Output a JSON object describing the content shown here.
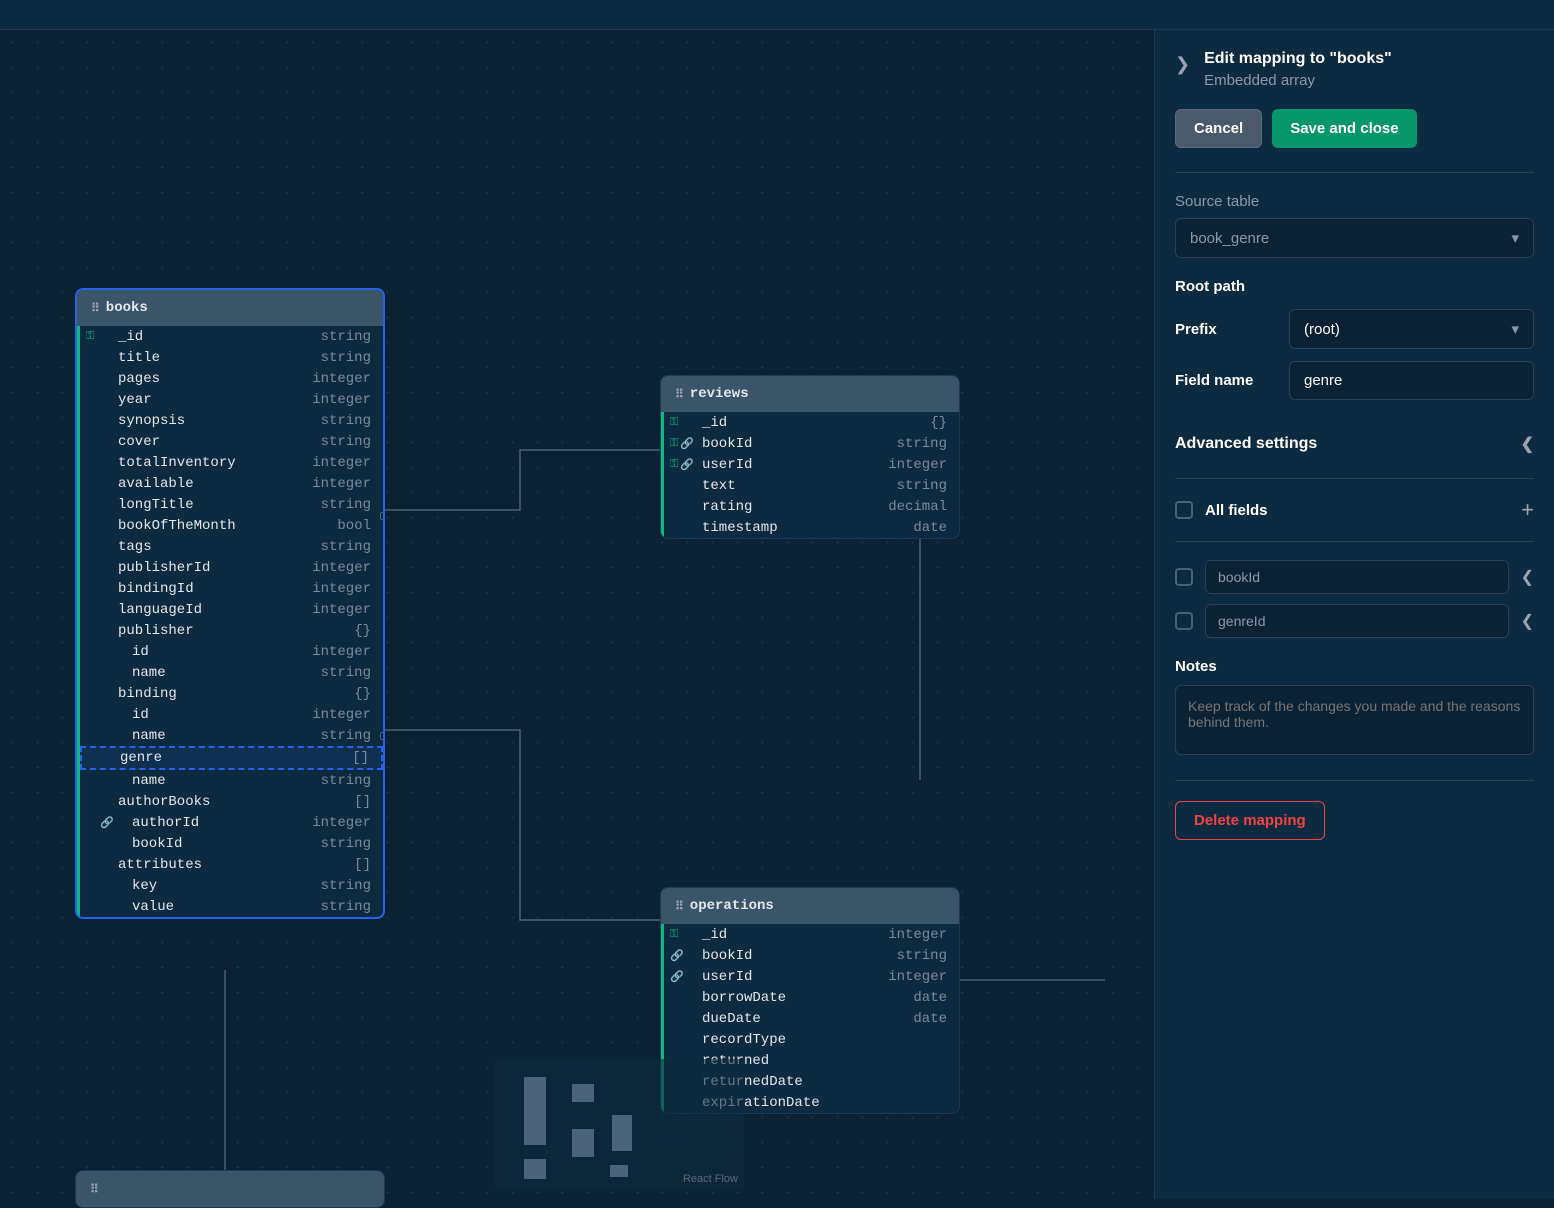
{
  "panel": {
    "title": "Edit mapping to \"books\"",
    "subtitle": "Embedded array",
    "cancel_label": "Cancel",
    "save_label": "Save and close",
    "source_table_label": "Source table",
    "source_table_value": "book_genre",
    "root_path_label": "Root path",
    "prefix_label": "Prefix",
    "prefix_value": "(root)",
    "field_name_label": "Field name",
    "field_name_value": "genre",
    "advanced_label": "Advanced settings",
    "all_fields_label": "All fields",
    "field_checks": [
      "bookId",
      "genreId"
    ],
    "notes_label": "Notes",
    "notes_placeholder": "Keep track of the changes you made and the reasons behind them.",
    "delete_label": "Delete mapping"
  },
  "minimap_attr": "React Flow",
  "entities": {
    "books": {
      "title": "books",
      "fields": [
        {
          "icons": [
            "key"
          ],
          "name": "_id",
          "type": "string"
        },
        {
          "icons": [],
          "name": "title",
          "type": "string"
        },
        {
          "icons": [],
          "name": "pages",
          "type": "integer"
        },
        {
          "icons": [],
          "name": "year",
          "type": "integer"
        },
        {
          "icons": [],
          "name": "synopsis",
          "type": "string"
        },
        {
          "icons": [],
          "name": "cover",
          "type": "string"
        },
        {
          "icons": [],
          "name": "totalInventory",
          "type": "integer"
        },
        {
          "icons": [],
          "name": "available",
          "type": "integer"
        },
        {
          "icons": [],
          "name": "longTitle",
          "type": "string"
        },
        {
          "icons": [],
          "name": "bookOfTheMonth",
          "type": "bool"
        },
        {
          "icons": [],
          "name": "tags",
          "type": "string"
        },
        {
          "icons": [],
          "name": "publisherId",
          "type": "integer"
        },
        {
          "icons": [],
          "name": "bindingId",
          "type": "integer"
        },
        {
          "icons": [],
          "name": "languageId",
          "type": "integer"
        },
        {
          "icons": [],
          "name": "publisher",
          "type": "{}"
        },
        {
          "icons": [],
          "name": "id",
          "type": "integer",
          "indent": true
        },
        {
          "icons": [],
          "name": "name",
          "type": "string",
          "indent": true
        },
        {
          "icons": [],
          "name": "binding",
          "type": "{}"
        },
        {
          "icons": [],
          "name": "id",
          "type": "integer",
          "indent": true
        },
        {
          "icons": [],
          "name": "name",
          "type": "string",
          "indent": true
        },
        {
          "icons": [],
          "name": "genre",
          "type": "[]",
          "highlighted": true
        },
        {
          "icons": [],
          "name": "name",
          "type": "string",
          "indent": true
        },
        {
          "icons": [],
          "name": "authorBooks",
          "type": "[]"
        },
        {
          "icons": [
            "link"
          ],
          "name": "authorId",
          "type": "integer",
          "indent": true
        },
        {
          "icons": [],
          "name": "bookId",
          "type": "string",
          "indent": true
        },
        {
          "icons": [],
          "name": "attributes",
          "type": "[]"
        },
        {
          "icons": [],
          "name": "key",
          "type": "string",
          "indent": true
        },
        {
          "icons": [],
          "name": "value",
          "type": "string",
          "indent": true
        }
      ]
    },
    "reviews": {
      "title": "reviews",
      "fields": [
        {
          "icons": [
            "key"
          ],
          "name": "_id",
          "type": "{}"
        },
        {
          "icons": [
            "key",
            "link"
          ],
          "name": "bookId",
          "type": "string"
        },
        {
          "icons": [
            "key",
            "link"
          ],
          "name": "userId",
          "type": "integer"
        },
        {
          "icons": [],
          "name": "text",
          "type": "string"
        },
        {
          "icons": [],
          "name": "rating",
          "type": "decimal"
        },
        {
          "icons": [],
          "name": "timestamp",
          "type": "date"
        }
      ]
    },
    "operations": {
      "title": "operations",
      "fields": [
        {
          "icons": [
            "key"
          ],
          "name": "_id",
          "type": "integer"
        },
        {
          "icons": [
            "link"
          ],
          "name": "bookId",
          "type": "string"
        },
        {
          "icons": [
            "link"
          ],
          "name": "userId",
          "type": "integer"
        },
        {
          "icons": [],
          "name": "borrowDate",
          "type": "date"
        },
        {
          "icons": [],
          "name": "dueDate",
          "type": "date"
        },
        {
          "icons": [],
          "name": "recordType",
          "type": ""
        },
        {
          "icons": [],
          "name": "returned",
          "type": ""
        },
        {
          "icons": [],
          "name": "returnedDate",
          "type": ""
        },
        {
          "icons": [],
          "name": "expirationDate",
          "type": ""
        }
      ]
    }
  }
}
